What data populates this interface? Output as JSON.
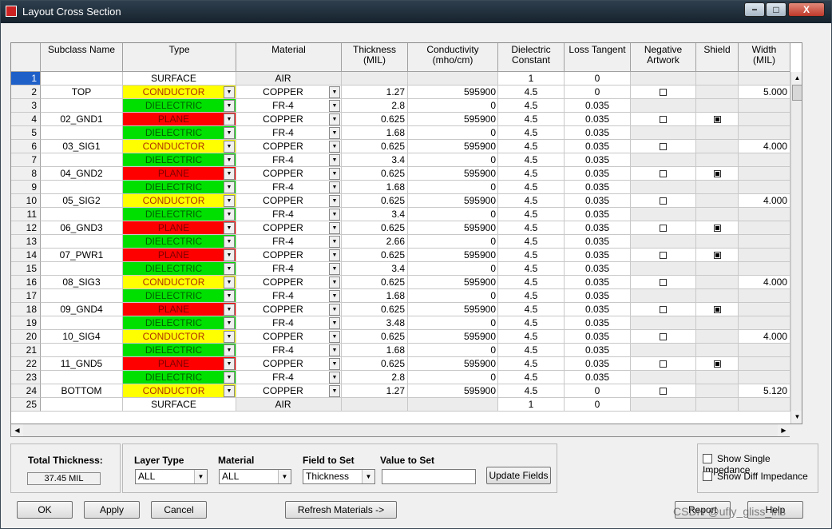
{
  "window": {
    "title": "Layout Cross Section",
    "min": "−",
    "max": "□",
    "close": "X"
  },
  "grid": {
    "columns": [
      "Subclass Name",
      "Type",
      "Material",
      "Thickness\n(MIL)",
      "Conductivity\n(mho/cm)",
      "Dielectric\nConstant",
      "Loss Tangent",
      "Negative\nArtwork",
      "Shield",
      "Width\n(MIL)"
    ],
    "selected_row": "1",
    "rows": [
      {
        "n": "1",
        "name": "",
        "type": "SURFACE",
        "kind": "surface",
        "mat": "AIR",
        "matdd": false,
        "thick": "",
        "cond": "",
        "diel": "1",
        "loss": "0",
        "neg": null,
        "shield": null,
        "width": "",
        "typedd": false
      },
      {
        "n": "2",
        "name": "TOP",
        "type": "CONDUCTOR",
        "kind": "conductor",
        "mat": "COPPER",
        "matdd": true,
        "thick": "1.27",
        "cond": "595900",
        "diel": "4.5",
        "loss": "0",
        "neg": false,
        "shield": null,
        "width": "5.000",
        "typedd": true
      },
      {
        "n": "3",
        "name": "",
        "type": "DIELECTRIC",
        "kind": "dielectric",
        "mat": "FR-4",
        "matdd": true,
        "thick": "2.8",
        "cond": "0",
        "diel": "4.5",
        "loss": "0.035",
        "neg": null,
        "shield": null,
        "width": "",
        "typedd": true
      },
      {
        "n": "4",
        "name": "02_GND1",
        "type": "PLANE",
        "kind": "plane",
        "mat": "COPPER",
        "matdd": true,
        "thick": "0.625",
        "cond": "595900",
        "diel": "4.5",
        "loss": "0.035",
        "neg": false,
        "shield": true,
        "width": "",
        "typedd": true
      },
      {
        "n": "5",
        "name": "",
        "type": "DIELECTRIC",
        "kind": "dielectric",
        "mat": "FR-4",
        "matdd": true,
        "thick": "1.68",
        "cond": "0",
        "diel": "4.5",
        "loss": "0.035",
        "neg": null,
        "shield": null,
        "width": "",
        "typedd": true
      },
      {
        "n": "6",
        "name": "03_SIG1",
        "type": "CONDUCTOR",
        "kind": "conductor",
        "mat": "COPPER",
        "matdd": true,
        "thick": "0.625",
        "cond": "595900",
        "diel": "4.5",
        "loss": "0.035",
        "neg": false,
        "shield": null,
        "width": "4.000",
        "typedd": true
      },
      {
        "n": "7",
        "name": "",
        "type": "DIELECTRIC",
        "kind": "dielectric",
        "mat": "FR-4",
        "matdd": true,
        "thick": "3.4",
        "cond": "0",
        "diel": "4.5",
        "loss": "0.035",
        "neg": null,
        "shield": null,
        "width": "",
        "typedd": true
      },
      {
        "n": "8",
        "name": "04_GND2",
        "type": "PLANE",
        "kind": "plane",
        "mat": "COPPER",
        "matdd": true,
        "thick": "0.625",
        "cond": "595900",
        "diel": "4.5",
        "loss": "0.035",
        "neg": false,
        "shield": true,
        "width": "",
        "typedd": true
      },
      {
        "n": "9",
        "name": "",
        "type": "DIELECTRIC",
        "kind": "dielectric",
        "mat": "FR-4",
        "matdd": true,
        "thick": "1.68",
        "cond": "0",
        "diel": "4.5",
        "loss": "0.035",
        "neg": null,
        "shield": null,
        "width": "",
        "typedd": true
      },
      {
        "n": "10",
        "name": "05_SIG2",
        "type": "CONDUCTOR",
        "kind": "conductor",
        "mat": "COPPER",
        "matdd": true,
        "thick": "0.625",
        "cond": "595900",
        "diel": "4.5",
        "loss": "0.035",
        "neg": false,
        "shield": null,
        "width": "4.000",
        "typedd": true
      },
      {
        "n": "11",
        "name": "",
        "type": "DIELECTRIC",
        "kind": "dielectric",
        "mat": "FR-4",
        "matdd": true,
        "thick": "3.4",
        "cond": "0",
        "diel": "4.5",
        "loss": "0.035",
        "neg": null,
        "shield": null,
        "width": "",
        "typedd": true
      },
      {
        "n": "12",
        "name": "06_GND3",
        "type": "PLANE",
        "kind": "plane",
        "mat": "COPPER",
        "matdd": true,
        "thick": "0.625",
        "cond": "595900",
        "diel": "4.5",
        "loss": "0.035",
        "neg": false,
        "shield": true,
        "width": "",
        "typedd": true
      },
      {
        "n": "13",
        "name": "",
        "type": "DIELECTRIC",
        "kind": "dielectric",
        "mat": "FR-4",
        "matdd": true,
        "thick": "2.66",
        "cond": "0",
        "diel": "4.5",
        "loss": "0.035",
        "neg": null,
        "shield": null,
        "width": "",
        "typedd": true
      },
      {
        "n": "14",
        "name": "07_PWR1",
        "type": "PLANE",
        "kind": "plane",
        "mat": "COPPER",
        "matdd": true,
        "thick": "0.625",
        "cond": "595900",
        "diel": "4.5",
        "loss": "0.035",
        "neg": false,
        "shield": true,
        "width": "",
        "typedd": true
      },
      {
        "n": "15",
        "name": "",
        "type": "DIELECTRIC",
        "kind": "dielectric",
        "mat": "FR-4",
        "matdd": true,
        "thick": "3.4",
        "cond": "0",
        "diel": "4.5",
        "loss": "0.035",
        "neg": null,
        "shield": null,
        "width": "",
        "typedd": true
      },
      {
        "n": "16",
        "name": "08_SIG3",
        "type": "CONDUCTOR",
        "kind": "conductor",
        "mat": "COPPER",
        "matdd": true,
        "thick": "0.625",
        "cond": "595900",
        "diel": "4.5",
        "loss": "0.035",
        "neg": false,
        "shield": null,
        "width": "4.000",
        "typedd": true
      },
      {
        "n": "17",
        "name": "",
        "type": "DIELECTRIC",
        "kind": "dielectric",
        "mat": "FR-4",
        "matdd": true,
        "thick": "1.68",
        "cond": "0",
        "diel": "4.5",
        "loss": "0.035",
        "neg": null,
        "shield": null,
        "width": "",
        "typedd": true
      },
      {
        "n": "18",
        "name": "09_GND4",
        "type": "PLANE",
        "kind": "plane",
        "mat": "COPPER",
        "matdd": true,
        "thick": "0.625",
        "cond": "595900",
        "diel": "4.5",
        "loss": "0.035",
        "neg": false,
        "shield": true,
        "width": "",
        "typedd": true
      },
      {
        "n": "19",
        "name": "",
        "type": "DIELECTRIC",
        "kind": "dielectric",
        "mat": "FR-4",
        "matdd": true,
        "thick": "3.48",
        "cond": "0",
        "diel": "4.5",
        "loss": "0.035",
        "neg": null,
        "shield": null,
        "width": "",
        "typedd": true
      },
      {
        "n": "20",
        "name": "10_SIG4",
        "type": "CONDUCTOR",
        "kind": "conductor",
        "mat": "COPPER",
        "matdd": true,
        "thick": "0.625",
        "cond": "595900",
        "diel": "4.5",
        "loss": "0.035",
        "neg": false,
        "shield": null,
        "width": "4.000",
        "typedd": true
      },
      {
        "n": "21",
        "name": "",
        "type": "DIELECTRIC",
        "kind": "dielectric",
        "mat": "FR-4",
        "matdd": true,
        "thick": "1.68",
        "cond": "0",
        "diel": "4.5",
        "loss": "0.035",
        "neg": null,
        "shield": null,
        "width": "",
        "typedd": true
      },
      {
        "n": "22",
        "name": "11_GND5",
        "type": "PLANE",
        "kind": "plane",
        "mat": "COPPER",
        "matdd": true,
        "thick": "0.625",
        "cond": "595900",
        "diel": "4.5",
        "loss": "0.035",
        "neg": false,
        "shield": true,
        "width": "",
        "typedd": true
      },
      {
        "n": "23",
        "name": "",
        "type": "DIELECTRIC",
        "kind": "dielectric",
        "mat": "FR-4",
        "matdd": true,
        "thick": "2.8",
        "cond": "0",
        "diel": "4.5",
        "loss": "0.035",
        "neg": null,
        "shield": null,
        "width": "",
        "typedd": true
      },
      {
        "n": "24",
        "name": "BOTTOM",
        "type": "CONDUCTOR",
        "kind": "conductor",
        "mat": "COPPER",
        "matdd": true,
        "thick": "1.27",
        "cond": "595900",
        "diel": "4.5",
        "loss": "0",
        "neg": false,
        "shield": null,
        "width": "5.120",
        "typedd": true
      },
      {
        "n": "25",
        "name": "",
        "type": "SURFACE",
        "kind": "surface",
        "mat": "AIR",
        "matdd": false,
        "thick": "",
        "cond": "",
        "diel": "1",
        "loss": "0",
        "neg": null,
        "shield": null,
        "width": "",
        "typedd": false
      }
    ]
  },
  "total": {
    "label": "Total Thickness:",
    "value": "37.45 MIL"
  },
  "set_fields": {
    "layer_type_label": "Layer Type",
    "layer_type_value": "ALL",
    "material_label": "Material",
    "material_value": "ALL",
    "field_label": "Field to Set",
    "field_value": "Thickness",
    "value_label": "Value to Set",
    "value_value": "",
    "update_button": "Update Fields"
  },
  "impedance": {
    "single": "Show Single Impedance",
    "diff": "Show Diff Impedance"
  },
  "buttons": {
    "ok": "OK",
    "apply": "Apply",
    "cancel": "Cancel",
    "refresh": "Refresh Materials ->",
    "report": "Report",
    "help": "Help"
  },
  "watermark": "CSDN @ufly_gliss_ins",
  "colors": {
    "conductor": "#ffff00",
    "plane": "#ff0000",
    "dielectric": "#00e000",
    "selection": "#1e5fc8"
  }
}
